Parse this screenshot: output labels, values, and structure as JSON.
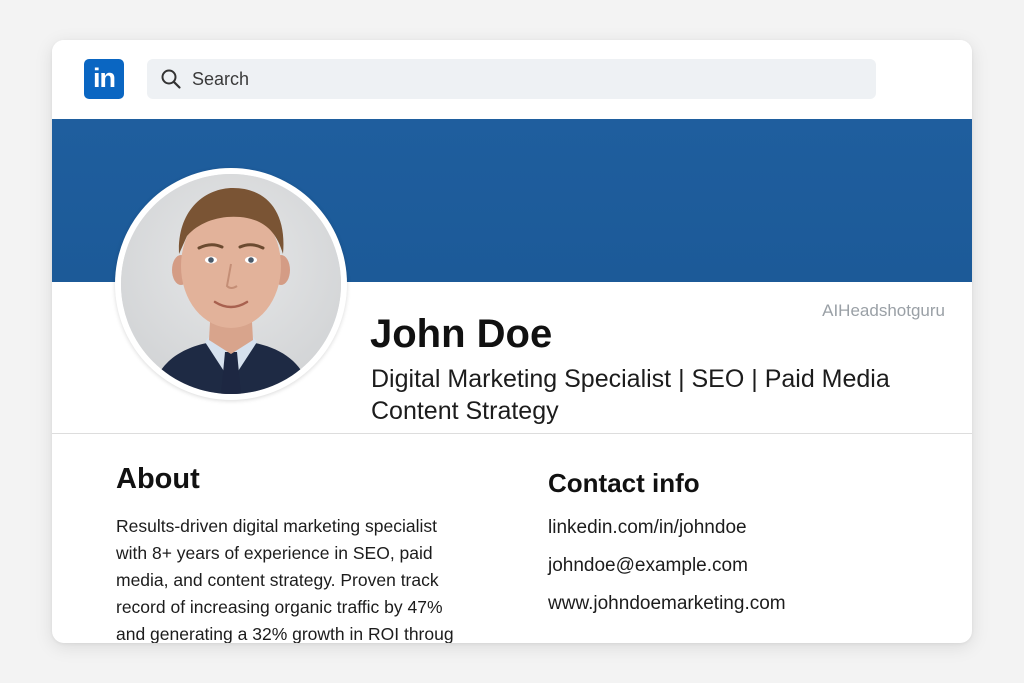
{
  "header": {
    "logo_text": "in",
    "search_placeholder": "Search",
    "brand_color": "#0a66c2"
  },
  "profile": {
    "banner_color": "#1f5e9e",
    "watermark": "AIHeadshotguru",
    "name": "John Doe",
    "headline_line1": "Digital Marketing Specialist | SEO | Paid Media",
    "headline_line2": "Content Strategy"
  },
  "about": {
    "title": "About",
    "lines": [
      "Results-driven digital marketing specialist",
      "with 8+ years of experience in SEO, paid",
      "media, and content strategy. Proven track",
      "record of increasing organic traffic by 47%",
      "and generating a 32% growth in ROI throug"
    ]
  },
  "contact": {
    "title": "Contact info",
    "items": [
      "linkedin.com/in/johndoe",
      "johndoe@example.com",
      "www.johndoemarketing.com"
    ]
  }
}
